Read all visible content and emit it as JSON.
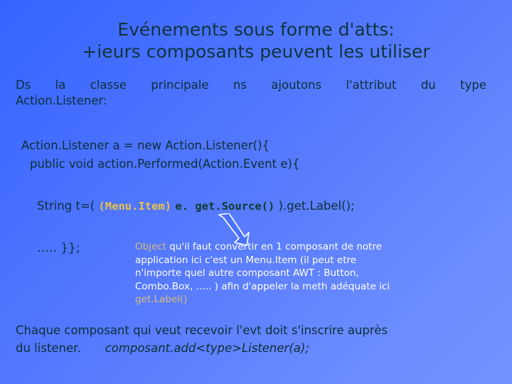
{
  "slide": {
    "background": {
      "from": "#3463ff",
      "to": "#7593ff",
      "direction": "135deg"
    },
    "title": {
      "line1": "Evénements sous forme d'atts:",
      "line2": "+ieurs composants peuvent les utiliser",
      "color": "#10343c"
    },
    "intro": {
      "words": [
        "Ds",
        "la",
        "classe",
        "principale",
        "ns",
        "ajoutons",
        "l'attribut",
        "du",
        "type"
      ],
      "line2": "Action.Listener:",
      "color": "#0d2f36"
    },
    "code": {
      "line1": "Action.Listener a = new Action.Listener(){",
      "line2": "public void action.Performed(Action.Event e){",
      "color": "#0d2f36"
    },
    "string_line": {
      "prefix": "String t=( ",
      "cast": "(Menu.Item)",
      "space": " ",
      "call": "e. get.Source()",
      "suffix": " ).get.Label();",
      "cast_color": "#e8c24a",
      "call_color": "#0f3b2e",
      "text_color": "#0d2f36"
    },
    "arrow": {
      "name": "down-right-arrow",
      "fill": "#4a72ff",
      "stroke": "#ffffff"
    },
    "closing_braces": "….. }};",
    "explanation": {
      "lead": "Object",
      "lead_color": "#d9bb7a",
      "lines": [
        " qu'il faut convertir en 1 composant de notre",
        "application ici c'est un Menu.Item (il peut etre",
        "n'importe quel autre composant AWT : Button,",
        "Combo.Box, ….. ) afin d'appeler la meth adéquate ici"
      ],
      "trailer": "get.Label()",
      "trailer_color": "#d9bb7a",
      "text_color": "#ffffff"
    },
    "bottom": {
      "line1": "Chaque composant qui veut recevoir l'evt doit s'inscrire auprès",
      "line2_plain": "du listener.",
      "line2_italic": "composant.add<type>Listener(a);",
      "color": "#0d2f36"
    }
  }
}
